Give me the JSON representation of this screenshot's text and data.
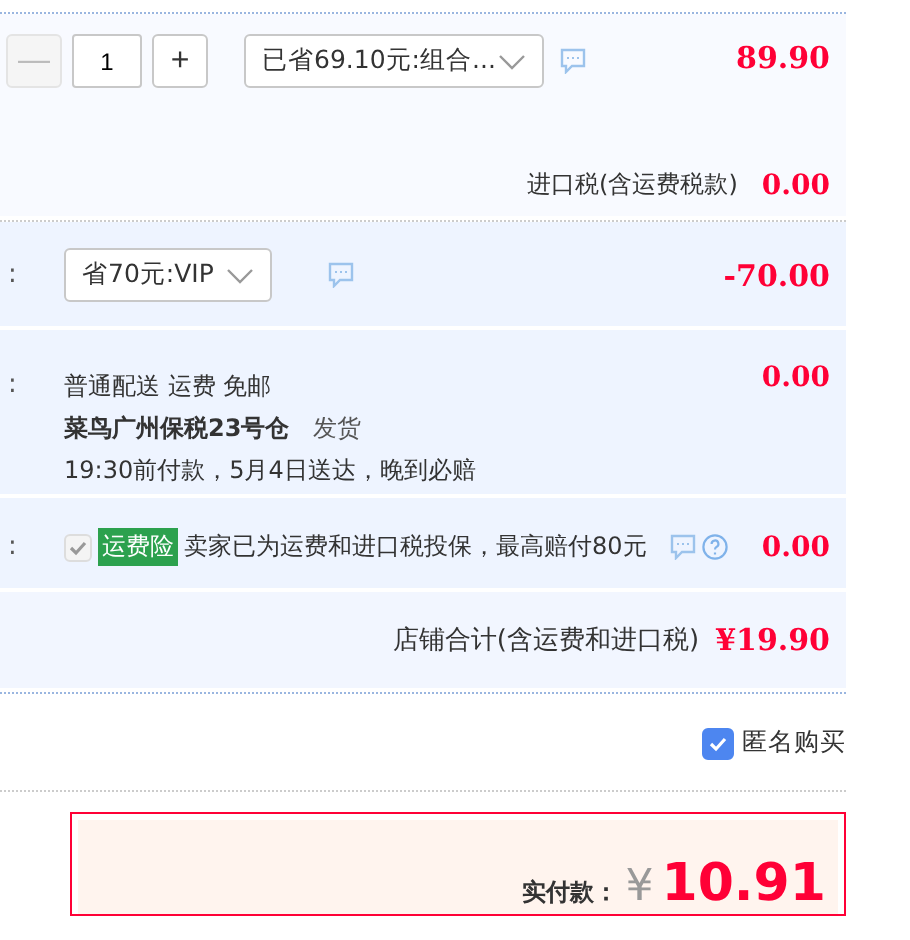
{
  "product": {
    "quantity": {
      "minus": "—",
      "value": "1",
      "plus": "+",
      "minus_disabled": true
    },
    "promo": "已省69.10元:组合...",
    "price": "89.90",
    "tax_label": "进口税(含运费税款)",
    "tax": "0.00"
  },
  "vip": {
    "colon": ":",
    "promo": "省70元:VIP",
    "amount": "-70.00"
  },
  "shipping": {
    "colon": ":",
    "method": "普通配送 运费 免邮",
    "warehouse": "菜鸟广州保税23号仓",
    "ship_word": "发货",
    "delivery": "19:30前付款，5月4日送达，晚到必赔",
    "amount": "0.00"
  },
  "insurance": {
    "colon": ":",
    "checked": true,
    "disabled": true,
    "badge": "运费险",
    "text": "卖家已为运费和进口税投保，最高赔付80元",
    "amount": "0.00"
  },
  "store_total": {
    "label": "店铺合计(含运费和进口税)",
    "amount": "¥19.90"
  },
  "anonymous": {
    "label": "匿名购买",
    "checked": true
  },
  "payment": {
    "label": "实付款：",
    "currency": "¥",
    "amount": "10.91"
  }
}
